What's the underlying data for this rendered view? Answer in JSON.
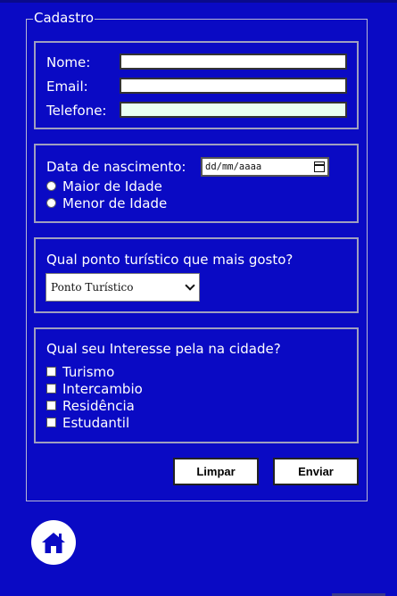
{
  "form": {
    "legend": "Cadastro",
    "contact": {
      "name_label": "Nome:",
      "email_label": "Email:",
      "phone_label": "Telefone:",
      "name_value": "",
      "email_value": "",
      "phone_value": ""
    },
    "birth": {
      "label": "Data de nascimento:",
      "date_placeholder": "dd/mm/aaaa",
      "radio_adult": "Maior de Idade",
      "radio_minor": "Menor de Idade"
    },
    "tourism": {
      "question": "Qual ponto turístico que mais gosto?",
      "select_value": "Ponto Turístico"
    },
    "interest": {
      "question": "Qual seu Interesse pela na cidade?",
      "options": [
        "Turismo",
        "Intercambio",
        "Residência",
        "Estudantil"
      ]
    },
    "buttons": {
      "clear": "Limpar",
      "send": "Enviar"
    }
  },
  "nav": {
    "home_icon": "home-icon"
  },
  "colors": {
    "background": "#0a0ac4",
    "text": "#ffffff",
    "phone_field_bg": "#e9fff2"
  }
}
